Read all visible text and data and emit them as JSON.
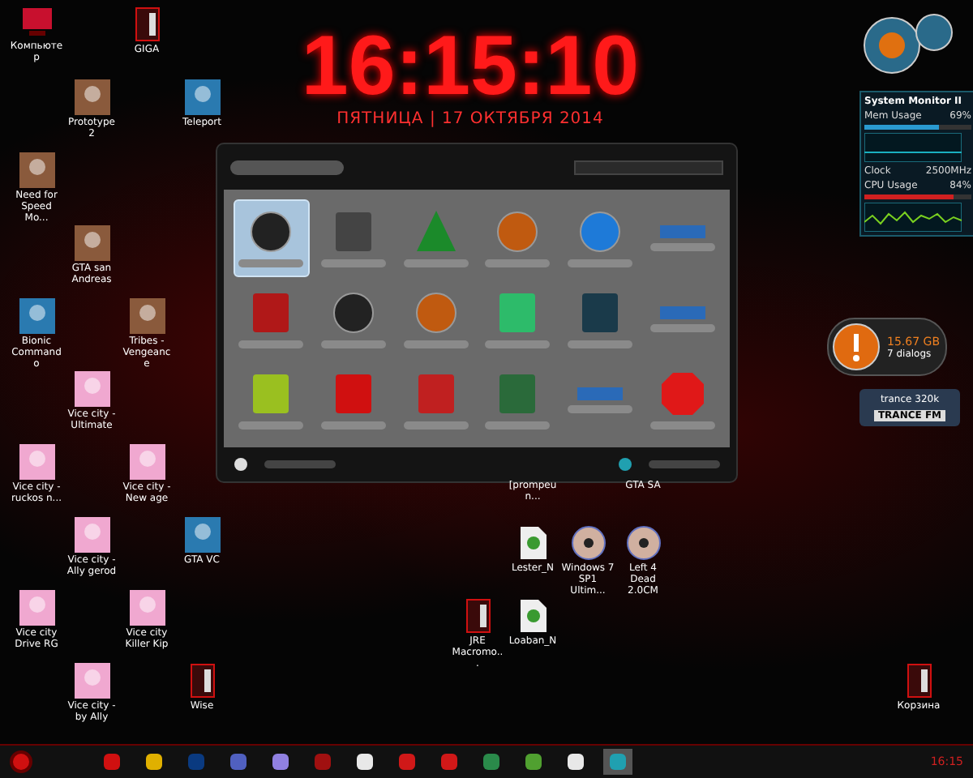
{
  "clock": {
    "time": "16:15:10",
    "date": "ПЯТНИЦА | 17 ОКТЯБРЯ 2014"
  },
  "desktop_icons": [
    {
      "label": "Компьютер",
      "kind": "computer"
    },
    {
      "label": "GIGA",
      "kind": "folder"
    },
    {
      "label": "Prototype 2",
      "kind": "photo"
    },
    {
      "label": "Teleport",
      "kind": "app"
    },
    {
      "label": "Need for Speed Mo...",
      "kind": "photo"
    },
    {
      "label": "GTA san Andreas",
      "kind": "photo"
    },
    {
      "label": "Bionic Commando",
      "kind": "app"
    },
    {
      "label": "Tribes - Vengeance",
      "kind": "photo"
    },
    {
      "label": "Vice city - Ultimate",
      "kind": "pink"
    },
    {
      "label": "Vice city - ruckos n...",
      "kind": "pink"
    },
    {
      "label": "Vice city - New age",
      "kind": "pink"
    },
    {
      "label": "Vice city - Ally gerod",
      "kind": "pink"
    },
    {
      "label": "GTA VC",
      "kind": "app"
    },
    {
      "label": "Vice city Drive RG",
      "kind": "pink"
    },
    {
      "label": "Vice city Killer Kip",
      "kind": "pink"
    },
    {
      "label": "Vice city - by Ally",
      "kind": "pink"
    },
    {
      "label": "Wise",
      "kind": "folder"
    },
    {
      "label": "[prompeun...",
      "kind": "none"
    },
    {
      "label": "GTA SA",
      "kind": "none"
    },
    {
      "label": "Lester_N",
      "kind": "torrent"
    },
    {
      "label": "Windows 7 SP1 Ultim...",
      "kind": "disc"
    },
    {
      "label": "Left 4 Dead 2.0CM",
      "kind": "disc"
    },
    {
      "label": "JRE Macromo...",
      "kind": "folder"
    },
    {
      "label": "Loaban_N",
      "kind": "torrent"
    },
    {
      "label": "Корзина",
      "kind": "folder"
    }
  ],
  "gadget_window": {
    "tiles": [
      {
        "kind": "gauge",
        "selected": true
      },
      {
        "kind": "calculator",
        "selected": false
      },
      {
        "kind": "tree",
        "selected": false
      },
      {
        "kind": "orb",
        "selected": false
      },
      {
        "kind": "bolt",
        "selected": false
      },
      {
        "kind": "strip",
        "selected": false
      },
      {
        "kind": "calendar",
        "selected": false
      },
      {
        "kind": "gauge",
        "selected": false
      },
      {
        "kind": "orb",
        "selected": false
      },
      {
        "kind": "recycle",
        "selected": false
      },
      {
        "kind": "chart",
        "selected": false
      },
      {
        "kind": "strip",
        "selected": false
      },
      {
        "kind": "clock",
        "selected": false
      },
      {
        "kind": "trash",
        "selected": false
      },
      {
        "kind": "news",
        "selected": false
      },
      {
        "kind": "chip",
        "selected": false
      },
      {
        "kind": "strip",
        "selected": false
      },
      {
        "kind": "close",
        "selected": false
      }
    ]
  },
  "system_monitor": {
    "title": "System Monitor II",
    "mem": {
      "label": "Mem Usage",
      "value": "69%",
      "level": 0.69
    },
    "clock_label": "Clock",
    "clock_value": "2500MHz",
    "cpu": {
      "label": "CPU Usage",
      "value": "84%",
      "level": 0.84
    }
  },
  "drive_gadget": {
    "size": "15.67 GB",
    "files": "7 dialogs"
  },
  "radio_gadget": {
    "station": "trance 320k",
    "logo": "TRANCE FM"
  },
  "taskbar": {
    "items": [
      {
        "kind": "play",
        "selected": false
      },
      {
        "kind": "triangle",
        "selected": false
      },
      {
        "kind": "ps",
        "selected": false
      },
      {
        "kind": "film",
        "selected": false
      },
      {
        "kind": "bow",
        "selected": false
      },
      {
        "kind": "gear",
        "selected": false
      },
      {
        "kind": "opera",
        "selected": false
      },
      {
        "kind": "redapp",
        "selected": false
      },
      {
        "kind": "redapp",
        "selected": false
      },
      {
        "kind": "squares",
        "selected": false
      },
      {
        "kind": "torrent",
        "selected": false
      },
      {
        "kind": "opera",
        "selected": false
      },
      {
        "kind": "globe",
        "selected": true
      }
    ],
    "time": "16:15"
  }
}
